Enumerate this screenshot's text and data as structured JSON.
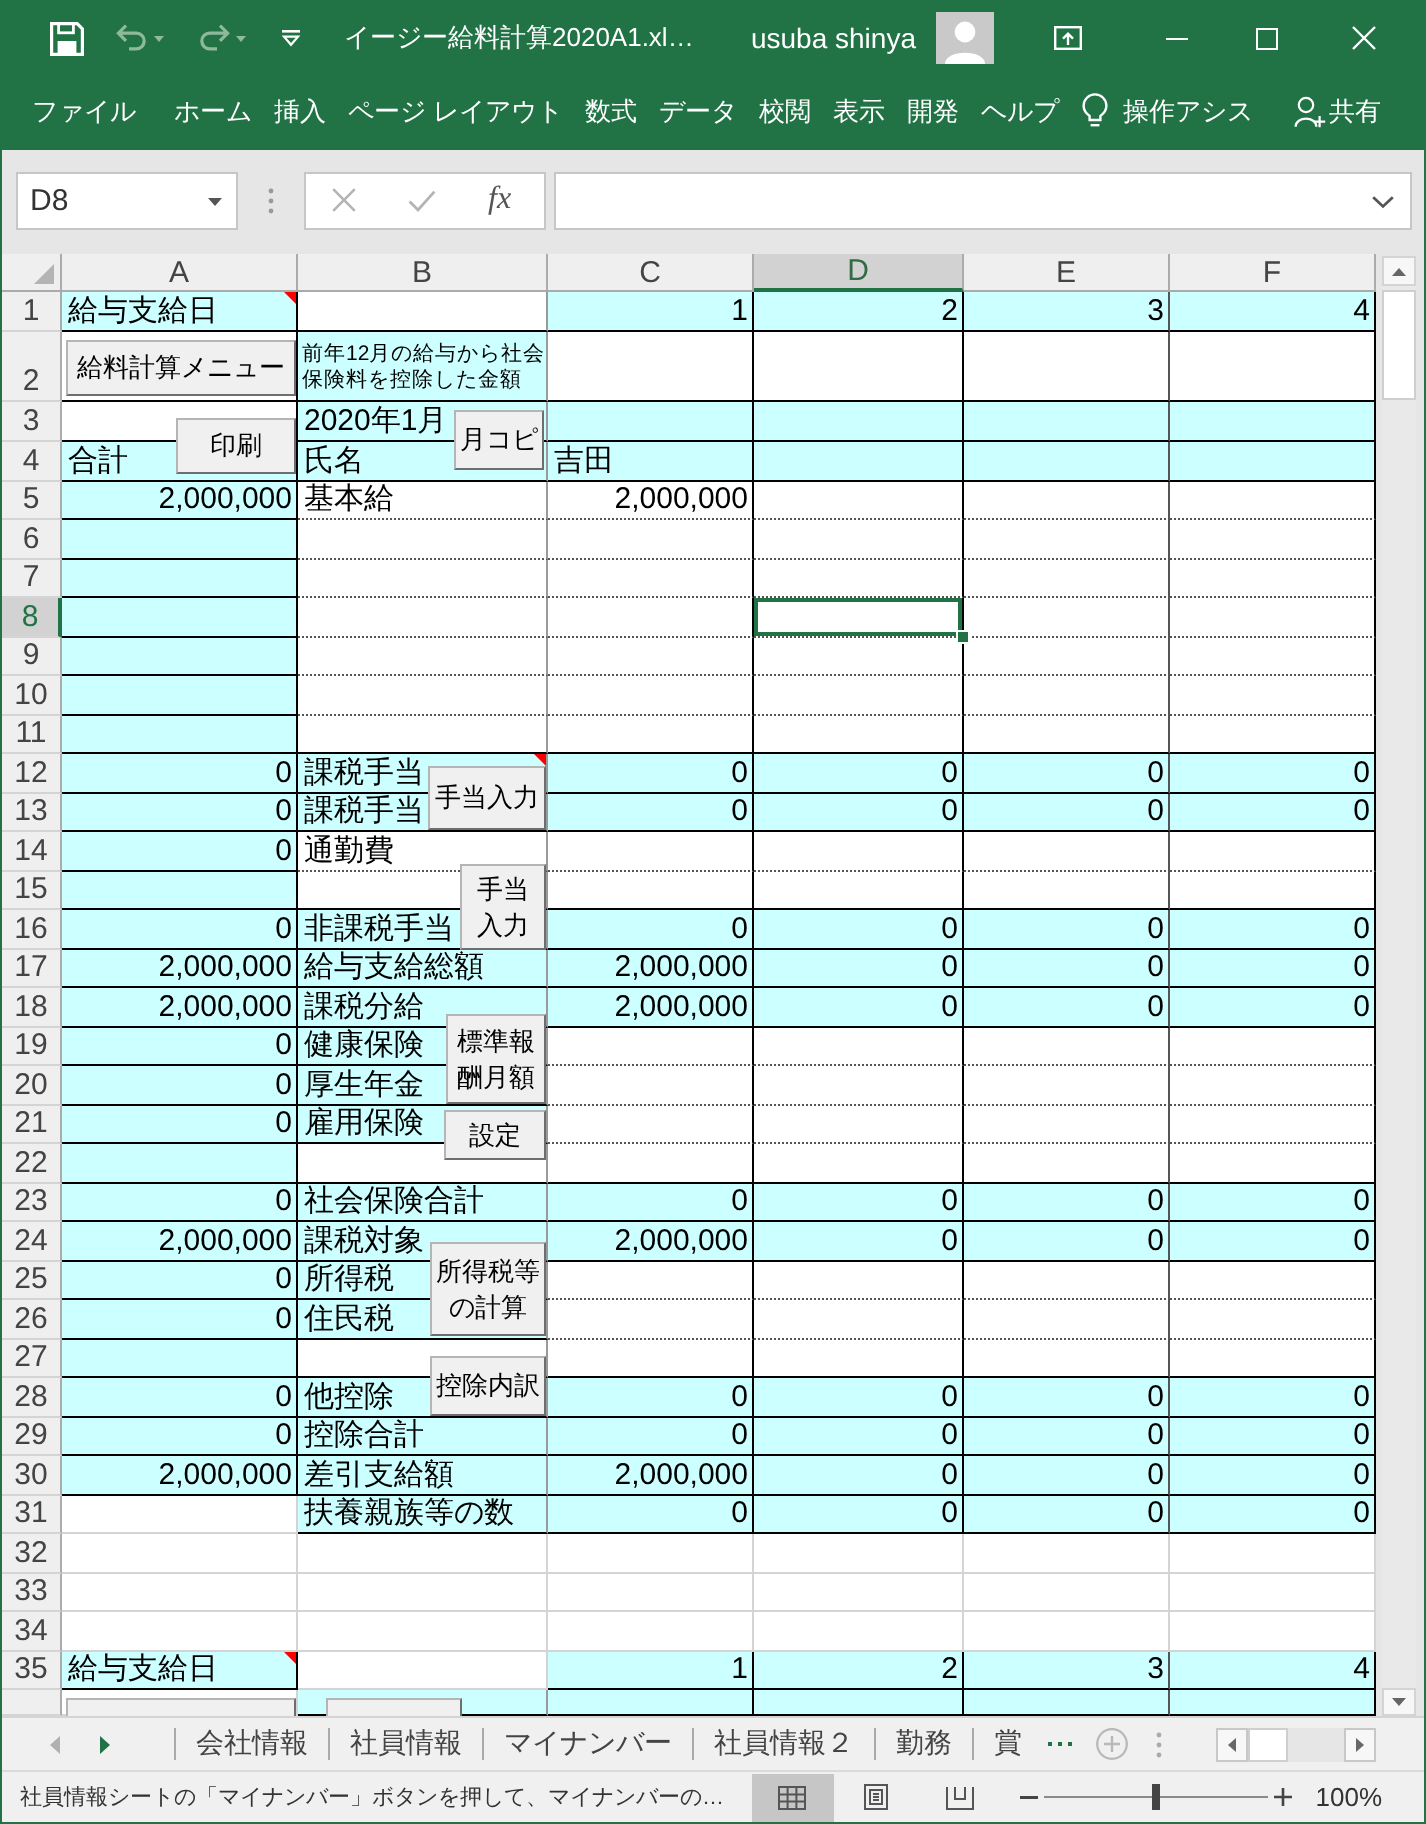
{
  "window": {
    "title": "イージー給料計算2020A1.xl…",
    "user": "usuba shinya"
  },
  "quick_access": [
    {
      "kind": "save",
      "disabled": false
    },
    {
      "kind": "undo",
      "disabled": true
    },
    {
      "kind": "redo",
      "disabled": true
    },
    {
      "kind": "customize",
      "disabled": false
    }
  ],
  "ribbon": {
    "tabs": [
      "ファイル",
      "ホーム",
      "挿入",
      "ページ レイアウト",
      "数式",
      "データ",
      "校閲",
      "表示",
      "開発",
      "ヘルプ"
    ],
    "tell_me": "操作アシス",
    "share": "共有"
  },
  "formula_bar": {
    "name_box": "D8",
    "function_label": "fx"
  },
  "sheet": {
    "columns": [
      {
        "label": "A",
        "selected": false
      },
      {
        "label": "B",
        "selected": false
      },
      {
        "label": "C",
        "selected": false
      },
      {
        "label": "D",
        "selected": true
      },
      {
        "label": "E",
        "selected": false
      },
      {
        "label": "F",
        "selected": false
      }
    ],
    "rows": [
      {
        "label": "1",
        "selected": false,
        "cells": [
          {
            "kind": "text",
            "text": "給与支給日",
            "shaded": true,
            "comment": true
          },
          {
            "kind": "blank",
            "shaded": false,
            "comment": false
          },
          {
            "kind": "number",
            "text": "1",
            "shaded": true,
            "comment": false
          },
          {
            "kind": "number",
            "text": "2",
            "shaded": true,
            "comment": false
          },
          {
            "kind": "number",
            "text": "3",
            "shaded": true,
            "comment": false
          },
          {
            "kind": "number",
            "text": "4",
            "shaded": true,
            "comment": false
          }
        ]
      },
      {
        "label": "2",
        "selected": false,
        "cells": [
          {
            "kind": "blank",
            "shaded": false,
            "comment": false
          },
          {
            "kind": "note",
            "text": "前年12月の給与から社会保険料を控除した金額",
            "shaded": true,
            "comment": false
          },
          {
            "kind": "blank",
            "shaded": false,
            "comment": false
          },
          {
            "kind": "blank",
            "shaded": false,
            "comment": false
          },
          {
            "kind": "blank",
            "shaded": false,
            "comment": false
          },
          {
            "kind": "blank",
            "shaded": false,
            "comment": false
          }
        ]
      },
      {
        "label": "3",
        "selected": false,
        "cells": [
          {
            "kind": "blank",
            "shaded": false,
            "comment": false
          },
          {
            "kind": "text",
            "text": "2020年1月",
            "shaded": true,
            "comment": false
          },
          {
            "kind": "blank",
            "shaded": true,
            "comment": false
          },
          {
            "kind": "blank",
            "shaded": true,
            "comment": false
          },
          {
            "kind": "blank",
            "shaded": true,
            "comment": false
          },
          {
            "kind": "blank",
            "shaded": true,
            "comment": false
          }
        ]
      },
      {
        "label": "4",
        "selected": false,
        "cells": [
          {
            "kind": "text",
            "text": "合計",
            "shaded": true,
            "comment": false
          },
          {
            "kind": "text",
            "text": "氏名",
            "shaded": true,
            "comment": false
          },
          {
            "kind": "text",
            "text": "吉田",
            "shaded": true,
            "comment": false
          },
          {
            "kind": "blank",
            "shaded": true,
            "comment": false
          },
          {
            "kind": "blank",
            "shaded": true,
            "comment": false
          },
          {
            "kind": "blank",
            "shaded": true,
            "comment": false
          }
        ]
      },
      {
        "label": "5",
        "selected": false,
        "cells": [
          {
            "kind": "number",
            "text": "2,000,000",
            "shaded": true,
            "comment": false
          },
          {
            "kind": "text",
            "text": "基本給",
            "shaded": false,
            "comment": false
          },
          {
            "kind": "number",
            "text": "2,000,000",
            "shaded": false,
            "comment": false
          },
          {
            "kind": "blank",
            "shaded": false,
            "comment": false
          },
          {
            "kind": "blank",
            "shaded": false,
            "comment": false
          },
          {
            "kind": "blank",
            "shaded": false,
            "comment": false
          }
        ]
      },
      {
        "label": "6",
        "selected": false,
        "cells": [
          {
            "kind": "blank",
            "shaded": true,
            "comment": false
          },
          {
            "kind": "blank",
            "shaded": false,
            "comment": false
          },
          {
            "kind": "blank",
            "shaded": false,
            "comment": false
          },
          {
            "kind": "blank",
            "shaded": false,
            "comment": false
          },
          {
            "kind": "blank",
            "shaded": false,
            "comment": false
          },
          {
            "kind": "blank",
            "shaded": false,
            "comment": false
          }
        ]
      },
      {
        "label": "7",
        "selected": false,
        "cells": [
          {
            "kind": "blank",
            "shaded": true,
            "comment": false
          },
          {
            "kind": "blank",
            "shaded": false,
            "comment": false
          },
          {
            "kind": "blank",
            "shaded": false,
            "comment": false
          },
          {
            "kind": "blank",
            "shaded": false,
            "comment": false
          },
          {
            "kind": "blank",
            "shaded": false,
            "comment": false
          },
          {
            "kind": "blank",
            "shaded": false,
            "comment": false
          }
        ]
      },
      {
        "label": "8",
        "selected": true,
        "cells": [
          {
            "kind": "blank",
            "shaded": true,
            "comment": false
          },
          {
            "kind": "blank",
            "shaded": false,
            "comment": false
          },
          {
            "kind": "blank",
            "shaded": false,
            "comment": false
          },
          {
            "kind": "blank",
            "shaded": false,
            "comment": false
          },
          {
            "kind": "blank",
            "shaded": false,
            "comment": false
          },
          {
            "kind": "blank",
            "shaded": false,
            "comment": false
          }
        ]
      },
      {
        "label": "9",
        "selected": false,
        "cells": [
          {
            "kind": "blank",
            "shaded": true,
            "comment": false
          },
          {
            "kind": "blank",
            "shaded": false,
            "comment": false
          },
          {
            "kind": "blank",
            "shaded": false,
            "comment": false
          },
          {
            "kind": "blank",
            "shaded": false,
            "comment": false
          },
          {
            "kind": "blank",
            "shaded": false,
            "comment": false
          },
          {
            "kind": "blank",
            "shaded": false,
            "comment": false
          }
        ]
      },
      {
        "label": "10",
        "selected": false,
        "cells": [
          {
            "kind": "blank",
            "shaded": true,
            "comment": false
          },
          {
            "kind": "blank",
            "shaded": false,
            "comment": false
          },
          {
            "kind": "blank",
            "shaded": false,
            "comment": false
          },
          {
            "kind": "blank",
            "shaded": false,
            "comment": false
          },
          {
            "kind": "blank",
            "shaded": false,
            "comment": false
          },
          {
            "kind": "blank",
            "shaded": false,
            "comment": false
          }
        ]
      },
      {
        "label": "11",
        "selected": false,
        "cells": [
          {
            "kind": "blank",
            "shaded": true,
            "comment": false
          },
          {
            "kind": "blank",
            "shaded": false,
            "comment": false
          },
          {
            "kind": "blank",
            "shaded": false,
            "comment": false
          },
          {
            "kind": "blank",
            "shaded": false,
            "comment": false
          },
          {
            "kind": "blank",
            "shaded": false,
            "comment": false
          },
          {
            "kind": "blank",
            "shaded": false,
            "comment": false
          }
        ]
      },
      {
        "label": "12",
        "selected": false,
        "cells": [
          {
            "kind": "number",
            "text": "0",
            "shaded": true,
            "comment": false
          },
          {
            "kind": "text",
            "text": "課税手当",
            "shaded": true,
            "comment": true
          },
          {
            "kind": "number",
            "text": "0",
            "shaded": true,
            "comment": false
          },
          {
            "kind": "number",
            "text": "0",
            "shaded": true,
            "comment": false
          },
          {
            "kind": "number",
            "text": "0",
            "shaded": true,
            "comment": false
          },
          {
            "kind": "number",
            "text": "0",
            "shaded": true,
            "comment": false
          }
        ]
      },
      {
        "label": "13",
        "selected": false,
        "cells": [
          {
            "kind": "number",
            "text": "0",
            "shaded": true,
            "comment": false
          },
          {
            "kind": "text",
            "text": "課税手当",
            "shaded": true,
            "comment": false
          },
          {
            "kind": "number",
            "text": "0",
            "shaded": true,
            "comment": false
          },
          {
            "kind": "number",
            "text": "0",
            "shaded": true,
            "comment": false
          },
          {
            "kind": "number",
            "text": "0",
            "shaded": true,
            "comment": false
          },
          {
            "kind": "number",
            "text": "0",
            "shaded": true,
            "comment": false
          }
        ]
      },
      {
        "label": "14",
        "selected": false,
        "cells": [
          {
            "kind": "number",
            "text": "0",
            "shaded": true,
            "comment": false
          },
          {
            "kind": "text",
            "text": "通勤費",
            "shaded": false,
            "comment": false
          },
          {
            "kind": "blank",
            "shaded": false,
            "comment": false
          },
          {
            "kind": "blank",
            "shaded": false,
            "comment": false
          },
          {
            "kind": "blank",
            "shaded": false,
            "comment": false
          },
          {
            "kind": "blank",
            "shaded": false,
            "comment": false
          }
        ]
      },
      {
        "label": "15",
        "selected": false,
        "cells": [
          {
            "kind": "blank",
            "shaded": true,
            "comment": false
          },
          {
            "kind": "blank",
            "shaded": false,
            "comment": false
          },
          {
            "kind": "blank",
            "shaded": false,
            "comment": false
          },
          {
            "kind": "blank",
            "shaded": false,
            "comment": false
          },
          {
            "kind": "blank",
            "shaded": false,
            "comment": false
          },
          {
            "kind": "blank",
            "shaded": false,
            "comment": false
          }
        ]
      },
      {
        "label": "16",
        "selected": false,
        "cells": [
          {
            "kind": "number",
            "text": "0",
            "shaded": true,
            "comment": false
          },
          {
            "kind": "text",
            "text": "非課税手当",
            "shaded": true,
            "comment": false
          },
          {
            "kind": "number",
            "text": "0",
            "shaded": true,
            "comment": false
          },
          {
            "kind": "number",
            "text": "0",
            "shaded": true,
            "comment": false
          },
          {
            "kind": "number",
            "text": "0",
            "shaded": true,
            "comment": false
          },
          {
            "kind": "number",
            "text": "0",
            "shaded": true,
            "comment": false
          }
        ]
      },
      {
        "label": "17",
        "selected": false,
        "cells": [
          {
            "kind": "number",
            "text": "2,000,000",
            "shaded": true,
            "comment": false
          },
          {
            "kind": "text",
            "text": "給与支給総額",
            "shaded": true,
            "comment": false
          },
          {
            "kind": "number",
            "text": "2,000,000",
            "shaded": true,
            "comment": false
          },
          {
            "kind": "number",
            "text": "0",
            "shaded": true,
            "comment": false
          },
          {
            "kind": "number",
            "text": "0",
            "shaded": true,
            "comment": false
          },
          {
            "kind": "number",
            "text": "0",
            "shaded": true,
            "comment": false
          }
        ]
      },
      {
        "label": "18",
        "selected": false,
        "cells": [
          {
            "kind": "number",
            "text": "2,000,000",
            "shaded": true,
            "comment": false
          },
          {
            "kind": "text",
            "text": "課税分給",
            "shaded": true,
            "comment": false
          },
          {
            "kind": "number",
            "text": "2,000,000",
            "shaded": true,
            "comment": false
          },
          {
            "kind": "number",
            "text": "0",
            "shaded": true,
            "comment": false
          },
          {
            "kind": "number",
            "text": "0",
            "shaded": true,
            "comment": false
          },
          {
            "kind": "number",
            "text": "0",
            "shaded": true,
            "comment": false
          }
        ]
      },
      {
        "label": "19",
        "selected": false,
        "cells": [
          {
            "kind": "number",
            "text": "0",
            "shaded": true,
            "comment": false
          },
          {
            "kind": "text",
            "text": "健康保険",
            "shaded": true,
            "comment": false
          },
          {
            "kind": "blank",
            "shaded": false,
            "comment": false
          },
          {
            "kind": "blank",
            "shaded": false,
            "comment": false
          },
          {
            "kind": "blank",
            "shaded": false,
            "comment": false
          },
          {
            "kind": "blank",
            "shaded": false,
            "comment": false
          }
        ]
      },
      {
        "label": "20",
        "selected": false,
        "cells": [
          {
            "kind": "number",
            "text": "0",
            "shaded": true,
            "comment": false
          },
          {
            "kind": "text",
            "text": "厚生年金",
            "shaded": true,
            "comment": false
          },
          {
            "kind": "blank",
            "shaded": false,
            "comment": false
          },
          {
            "kind": "blank",
            "shaded": false,
            "comment": false
          },
          {
            "kind": "blank",
            "shaded": false,
            "comment": false
          },
          {
            "kind": "blank",
            "shaded": false,
            "comment": false
          }
        ]
      },
      {
        "label": "21",
        "selected": false,
        "cells": [
          {
            "kind": "number",
            "text": "0",
            "shaded": true,
            "comment": false
          },
          {
            "kind": "text",
            "text": "雇用保険",
            "shaded": true,
            "comment": false
          },
          {
            "kind": "blank",
            "shaded": false,
            "comment": false
          },
          {
            "kind": "blank",
            "shaded": false,
            "comment": false
          },
          {
            "kind": "blank",
            "shaded": false,
            "comment": false
          },
          {
            "kind": "blank",
            "shaded": false,
            "comment": false
          }
        ]
      },
      {
        "label": "22",
        "selected": false,
        "cells": [
          {
            "kind": "blank",
            "shaded": true,
            "comment": false
          },
          {
            "kind": "blank",
            "shaded": false,
            "comment": false
          },
          {
            "kind": "blank",
            "shaded": false,
            "comment": false
          },
          {
            "kind": "blank",
            "shaded": false,
            "comment": false
          },
          {
            "kind": "blank",
            "shaded": false,
            "comment": false
          },
          {
            "kind": "blank",
            "shaded": false,
            "comment": false
          }
        ]
      },
      {
        "label": "23",
        "selected": false,
        "cells": [
          {
            "kind": "number",
            "text": "0",
            "shaded": true,
            "comment": false
          },
          {
            "kind": "text",
            "text": "社会保険合計",
            "shaded": true,
            "comment": false
          },
          {
            "kind": "number",
            "text": "0",
            "shaded": true,
            "comment": false
          },
          {
            "kind": "number",
            "text": "0",
            "shaded": true,
            "comment": false
          },
          {
            "kind": "number",
            "text": "0",
            "shaded": true,
            "comment": false
          },
          {
            "kind": "number",
            "text": "0",
            "shaded": true,
            "comment": false
          }
        ]
      },
      {
        "label": "24",
        "selected": false,
        "cells": [
          {
            "kind": "number",
            "text": "2,000,000",
            "shaded": true,
            "comment": false
          },
          {
            "kind": "text",
            "text": "課税対象",
            "shaded": true,
            "comment": false
          },
          {
            "kind": "number",
            "text": "2,000,000",
            "shaded": true,
            "comment": false
          },
          {
            "kind": "number",
            "text": "0",
            "shaded": true,
            "comment": false
          },
          {
            "kind": "number",
            "text": "0",
            "shaded": true,
            "comment": false
          },
          {
            "kind": "number",
            "text": "0",
            "shaded": true,
            "comment": false
          }
        ]
      },
      {
        "label": "25",
        "selected": false,
        "cells": [
          {
            "kind": "number",
            "text": "0",
            "shaded": true,
            "comment": false
          },
          {
            "kind": "text",
            "text": "所得税",
            "shaded": true,
            "comment": false
          },
          {
            "kind": "blank",
            "shaded": false,
            "comment": false
          },
          {
            "kind": "blank",
            "shaded": false,
            "comment": false
          },
          {
            "kind": "blank",
            "shaded": false,
            "comment": false
          },
          {
            "kind": "blank",
            "shaded": false,
            "comment": false
          }
        ]
      },
      {
        "label": "26",
        "selected": false,
        "cells": [
          {
            "kind": "number",
            "text": "0",
            "shaded": true,
            "comment": false
          },
          {
            "kind": "text",
            "text": "住民税",
            "shaded": true,
            "comment": false
          },
          {
            "kind": "blank",
            "shaded": false,
            "comment": false
          },
          {
            "kind": "blank",
            "shaded": false,
            "comment": false
          },
          {
            "kind": "blank",
            "shaded": false,
            "comment": false
          },
          {
            "kind": "blank",
            "shaded": false,
            "comment": false
          }
        ]
      },
      {
        "label": "27",
        "selected": false,
        "cells": [
          {
            "kind": "blank",
            "shaded": true,
            "comment": false
          },
          {
            "kind": "blank",
            "shaded": false,
            "comment": false
          },
          {
            "kind": "blank",
            "shaded": false,
            "comment": false
          },
          {
            "kind": "blank",
            "shaded": false,
            "comment": false
          },
          {
            "kind": "blank",
            "shaded": false,
            "comment": false
          },
          {
            "kind": "blank",
            "shaded": false,
            "comment": false
          }
        ]
      },
      {
        "label": "28",
        "selected": false,
        "cells": [
          {
            "kind": "number",
            "text": "0",
            "shaded": true,
            "comment": false
          },
          {
            "kind": "text",
            "text": "他控除",
            "shaded": true,
            "comment": false
          },
          {
            "kind": "number",
            "text": "0",
            "shaded": true,
            "comment": false
          },
          {
            "kind": "number",
            "text": "0",
            "shaded": true,
            "comment": false
          },
          {
            "kind": "number",
            "text": "0",
            "shaded": true,
            "comment": false
          },
          {
            "kind": "number",
            "text": "0",
            "shaded": true,
            "comment": false
          }
        ]
      },
      {
        "label": "29",
        "selected": false,
        "cells": [
          {
            "kind": "number",
            "text": "0",
            "shaded": true,
            "comment": false
          },
          {
            "kind": "text",
            "text": "控除合計",
            "shaded": true,
            "comment": false
          },
          {
            "kind": "number",
            "text": "0",
            "shaded": true,
            "comment": false
          },
          {
            "kind": "number",
            "text": "0",
            "shaded": true,
            "comment": false
          },
          {
            "kind": "number",
            "text": "0",
            "shaded": true,
            "comment": false
          },
          {
            "kind": "number",
            "text": "0",
            "shaded": true,
            "comment": false
          }
        ]
      },
      {
        "label": "30",
        "selected": false,
        "cells": [
          {
            "kind": "number",
            "text": "2,000,000",
            "shaded": true,
            "comment": false
          },
          {
            "kind": "text",
            "text": "差引支給額",
            "shaded": true,
            "comment": false
          },
          {
            "kind": "number",
            "text": "2,000,000",
            "shaded": true,
            "comment": false
          },
          {
            "kind": "number",
            "text": "0",
            "shaded": true,
            "comment": false
          },
          {
            "kind": "number",
            "text": "0",
            "shaded": true,
            "comment": false
          },
          {
            "kind": "number",
            "text": "0",
            "shaded": true,
            "comment": false
          }
        ]
      },
      {
        "label": "31",
        "selected": false,
        "cells": [
          {
            "kind": "blank",
            "shaded": false,
            "comment": false
          },
          {
            "kind": "text",
            "text": "扶養親族等の数",
            "shaded": true,
            "comment": false
          },
          {
            "kind": "number",
            "text": "0",
            "shaded": true,
            "comment": false
          },
          {
            "kind": "number",
            "text": "0",
            "shaded": true,
            "comment": false
          },
          {
            "kind": "number",
            "text": "0",
            "shaded": true,
            "comment": false
          },
          {
            "kind": "number",
            "text": "0",
            "shaded": true,
            "comment": false
          }
        ]
      },
      {
        "label": "32",
        "selected": false,
        "cells": [
          {
            "kind": "blank",
            "shaded": false,
            "comment": false
          },
          {
            "kind": "blank",
            "shaded": false,
            "comment": false
          },
          {
            "kind": "blank",
            "shaded": false,
            "comment": false
          },
          {
            "kind": "blank",
            "shaded": false,
            "comment": false
          },
          {
            "kind": "blank",
            "shaded": false,
            "comment": false
          },
          {
            "kind": "blank",
            "shaded": false,
            "comment": false
          }
        ]
      },
      {
        "label": "33",
        "selected": false,
        "cells": [
          {
            "kind": "blank",
            "shaded": false,
            "comment": false
          },
          {
            "kind": "blank",
            "shaded": false,
            "comment": false
          },
          {
            "kind": "blank",
            "shaded": false,
            "comment": false
          },
          {
            "kind": "blank",
            "shaded": false,
            "comment": false
          },
          {
            "kind": "blank",
            "shaded": false,
            "comment": false
          },
          {
            "kind": "blank",
            "shaded": false,
            "comment": false
          }
        ]
      },
      {
        "label": "34",
        "selected": false,
        "cells": [
          {
            "kind": "blank",
            "shaded": false,
            "comment": false
          },
          {
            "kind": "blank",
            "shaded": false,
            "comment": false
          },
          {
            "kind": "blank",
            "shaded": false,
            "comment": false
          },
          {
            "kind": "blank",
            "shaded": false,
            "comment": false
          },
          {
            "kind": "blank",
            "shaded": false,
            "comment": false
          },
          {
            "kind": "blank",
            "shaded": false,
            "comment": false
          }
        ]
      },
      {
        "label": "35",
        "selected": false,
        "cells": [
          {
            "kind": "text",
            "text": "給与支給日",
            "shaded": true,
            "comment": true
          },
          {
            "kind": "blank",
            "shaded": false,
            "comment": false
          },
          {
            "kind": "number",
            "text": "1",
            "shaded": true,
            "comment": false
          },
          {
            "kind": "number",
            "text": "2",
            "shaded": true,
            "comment": false
          },
          {
            "kind": "number",
            "text": "3",
            "shaded": true,
            "comment": false
          },
          {
            "kind": "number",
            "text": "4",
            "shaded": true,
            "comment": false
          }
        ]
      },
      {
        "selected": false,
        "cells": [
          {
            "kind": "blank",
            "shaded": false,
            "comment": false
          },
          {
            "kind": "blank",
            "shaded": true,
            "comment": false
          },
          {
            "kind": "blank",
            "shaded": true,
            "comment": false
          },
          {
            "kind": "blank",
            "shaded": true,
            "comment": false
          },
          {
            "kind": "blank",
            "shaded": true,
            "comment": false
          },
          {
            "kind": "blank",
            "shaded": true,
            "comment": false
          }
        ]
      }
    ],
    "buttons": [
      {
        "kind": "full",
        "label": "給料計算メニュー"
      },
      {
        "kind": "full",
        "label": "印刷"
      },
      {
        "kind": "full",
        "label": "月コピ"
      },
      {
        "kind": "full",
        "label": "手当入力"
      },
      {
        "kind": "full",
        "label": "手当入力"
      },
      {
        "kind": "full",
        "label": "標準報酬月額"
      },
      {
        "kind": "full",
        "label": "設定"
      },
      {
        "kind": "full",
        "label": "所得税等の計算"
      },
      {
        "kind": "full",
        "label": "控除内訳"
      },
      {
        "kind": "clipped"
      },
      {
        "kind": "clipped"
      }
    ]
  },
  "sheet_tabs": [
    {
      "label": "会社情報",
      "selected": false
    },
    {
      "label": "社員情報",
      "selected": false
    },
    {
      "label": "マイナンバー",
      "selected": false
    },
    {
      "label": "社員情報２",
      "selected": false
    },
    {
      "label": "勤務",
      "selected": false
    },
    {
      "label": "賞",
      "selected": false
    }
  ],
  "status_bar": {
    "message": "社員情報シートの「マイナンバー」ボタンを押して、マイナンバーの…",
    "views": [
      {
        "kind": "normal",
        "selected": true
      },
      {
        "kind": "page_layout",
        "selected": false
      },
      {
        "kind": "page_break",
        "selected": false
      }
    ],
    "zoom": {
      "level": 0.5,
      "reading": "100%"
    }
  }
}
